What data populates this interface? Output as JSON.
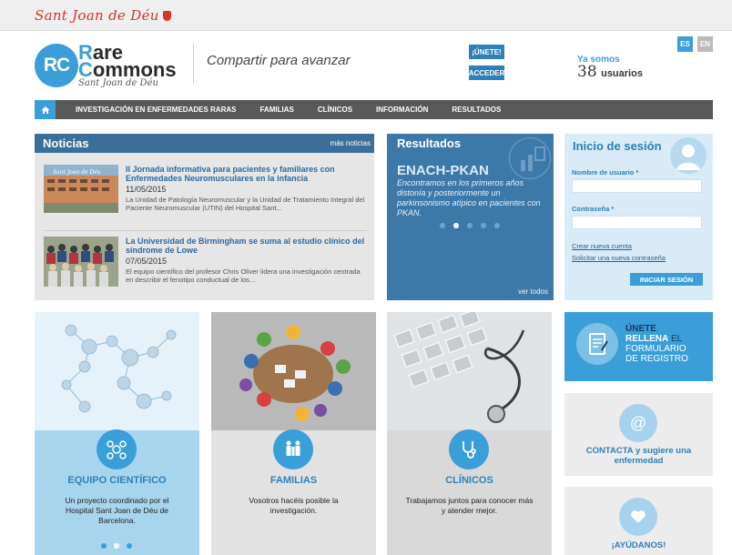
{
  "topbar": {
    "brand": "Sant Joan de Déu",
    "crest_icon": "crest-icon"
  },
  "header": {
    "logo_initials": "RC",
    "logo_line1": "Rare",
    "logo_line2": "Commons",
    "logo_line3": "Sant Joan de Déu",
    "tagline": "Compartir para avanzar",
    "join_label": "¡ÚNETE!",
    "access_label": "ACCEDER",
    "ya_somos": "Ya somos",
    "user_count": "38",
    "users_label": "usuarios",
    "lang_es": "ES",
    "lang_en": "EN"
  },
  "nav": {
    "home_icon": "home-icon",
    "items": [
      "INVESTIGACIÓN EN ENFERMEDADES RARAS",
      "FAMILIAS",
      "CLÍNICOS",
      "INFORMACIÓN",
      "RESULTADOS"
    ]
  },
  "noticias": {
    "title": "Noticias",
    "more": "más noticias",
    "items": [
      {
        "title": "II Jornada informativa para pacientes y familiares con Enfermedades Neuromusculares en la infancia",
        "date": "11/05/2015",
        "summary": "La Unidad de Patología Neuromuscular y la Unidad de Tratamiento Integral del Paciente Neuromuscular (UTIN) del Hospital Sant..."
      },
      {
        "title": "La Universidad de Birmingham se suma al estudio clínico del síndrome de Lowe",
        "date": "07/05/2015",
        "summary": "El equipo científico del profesor Chris Oliver lidera una investigación centrada en describir el fenotipo conductual de los..."
      }
    ]
  },
  "resultados": {
    "title": "Resultados",
    "item_title": "ENACH-PKAN",
    "item_desc": "Encontramos en los primeros años distonía y posteriormente un parkinsonismo atípico en pacientes con PKAN.",
    "see_all": "ver todos",
    "active_slide": 1
  },
  "login": {
    "title": "Inicio de sesión",
    "user_label": "Nombre de usuario *",
    "pass_label": "Contraseña *",
    "user_value": "",
    "pass_value": "",
    "create_account": "Crear nueva cuenta",
    "request_password": "Solicitar una nueva contraseña",
    "submit": "INICIAR SESIÓN"
  },
  "cards": [
    {
      "title": "EQUIPO CIENTÍFICO",
      "desc": "Un proyecto coordinado por el Hospital Sant Joan de Déu de Barcelona.",
      "icon": "team-icon"
    },
    {
      "title": "FAMILIAS",
      "desc": "Vosotros hacéis posible la investigación.",
      "icon": "family-icon"
    },
    {
      "title": "CLÍNICOS",
      "desc": "Trabajamos juntos para conocer más y atender mejor.",
      "icon": "stethoscope-icon"
    }
  ],
  "side": {
    "join_line1": "ÚNETE",
    "join_line2": "RELLENA",
    "join_line2b": "EL",
    "join_line3": "FORMULARIO",
    "join_line4": "DE REGISTRO",
    "contact": "CONTACTA y sugiere una enfermedad",
    "help": "¡AYÚDANOS!"
  },
  "colors": {
    "accent": "#3a9ed9",
    "nav_bg": "#595959",
    "panel_head": "#3b6f9a",
    "results_bg": "#3d79a8"
  }
}
